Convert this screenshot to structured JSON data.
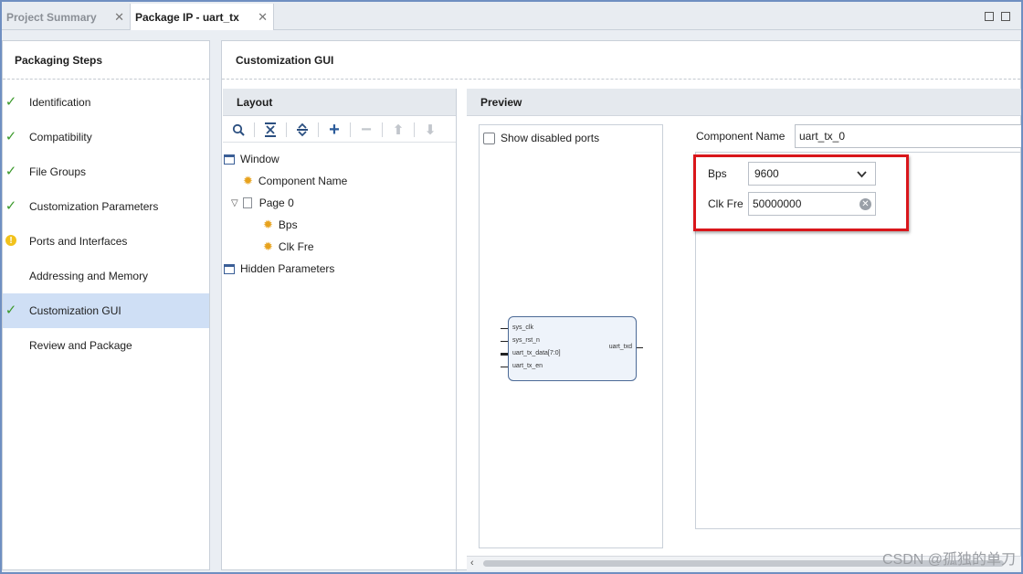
{
  "tabs": [
    {
      "label": "Project Summary",
      "active": false
    },
    {
      "label": "Package IP - uart_tx",
      "active": true
    }
  ],
  "packaging_steps": {
    "title": "Packaging Steps",
    "items": [
      {
        "label": "Identification",
        "status": "check"
      },
      {
        "label": "Compatibility",
        "status": "check"
      },
      {
        "label": "File Groups",
        "status": "check"
      },
      {
        "label": "Customization Parameters",
        "status": "check"
      },
      {
        "label": "Ports and Interfaces",
        "status": "warning"
      },
      {
        "label": "Addressing and Memory",
        "status": "none"
      },
      {
        "label": "Customization GUI",
        "status": "check",
        "selected": true
      },
      {
        "label": "Review and Package",
        "status": "none"
      }
    ]
  },
  "main": {
    "title": "Customization GUI"
  },
  "layout": {
    "title": "Layout",
    "tree": {
      "window": "Window",
      "component_name": "Component Name",
      "page0": "Page 0",
      "bps": "Bps",
      "clk_fre": "Clk Fre",
      "hidden_parameters": "Hidden Parameters"
    }
  },
  "preview": {
    "title": "Preview",
    "show_disabled_ports": "Show disabled ports",
    "component_name_label": "Component Name",
    "component_name_value": "uart_tx_0",
    "bps_label": "Bps",
    "bps_value": "9600",
    "clk_fre_label": "Clk Fre",
    "clk_fre_value": "50000000",
    "symbol": {
      "inputs": [
        "sys_clk",
        "sys_rst_n",
        "uart_tx_data[7:0]",
        "uart_tx_en"
      ],
      "outputs": [
        "uart_txd"
      ]
    }
  },
  "watermark": "CSDN @孤独的单刀",
  "colors": {
    "accent": "#cfdff5",
    "highlight": "#d9161b",
    "check": "#3c9a2c",
    "warning": "#f2c21b"
  }
}
